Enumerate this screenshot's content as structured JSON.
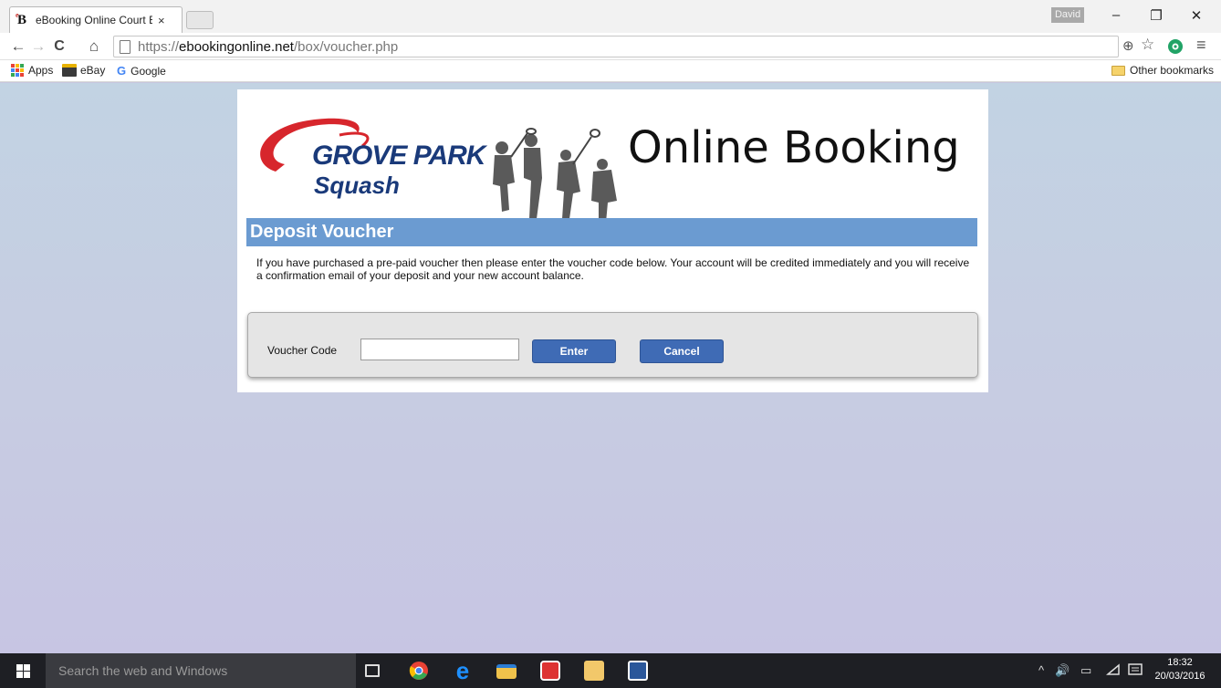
{
  "browser": {
    "tab_title": "eBooking Online Court Bo",
    "tab_close": "×",
    "user_badge": "David",
    "window_controls": {
      "minimize": "–",
      "restore": "❐",
      "close": "✕"
    },
    "nav": {
      "back": "←",
      "forward": "→",
      "reload": "C",
      "home": "⌂"
    },
    "url_scheme": "https://",
    "url_host": "ebookingonline.net",
    "url_path": "/box/voucher.php",
    "toolbar_right": {
      "zoom": "⊕",
      "star": "☆",
      "menu": "≡"
    },
    "bookmarks": [
      {
        "label": "Apps",
        "icon": "apps-grid-icon"
      },
      {
        "label": "eBay",
        "icon": "ebay-bag-icon"
      },
      {
        "label": "Google",
        "icon": "google-g-icon"
      }
    ],
    "other_bookmarks": "Other bookmarks"
  },
  "page": {
    "logo_line1": "GROVE PARK",
    "logo_line2": "Squash",
    "heading": "Online Booking",
    "section_title": "Deposit Voucher",
    "intro": "If you have purchased a pre-paid voucher then please enter the voucher code below. Your account will be credited immediately and you will receive a confirmation email of your deposit and your new account balance.",
    "form": {
      "voucher_label": "Voucher Code",
      "voucher_value": "",
      "enter_label": "Enter",
      "cancel_label": "Cancel"
    }
  },
  "taskbar": {
    "search_placeholder": "Search the web and Windows",
    "tray": {
      "chevron": "^",
      "volume": "🔊",
      "battery": "▭"
    },
    "time": "18:32",
    "date": "20/03/2016"
  },
  "colors": {
    "section_bar": "#6b9bd1",
    "button": "#3f6bb5",
    "logo_red": "#d7262c",
    "logo_navy": "#1a3a7a"
  }
}
